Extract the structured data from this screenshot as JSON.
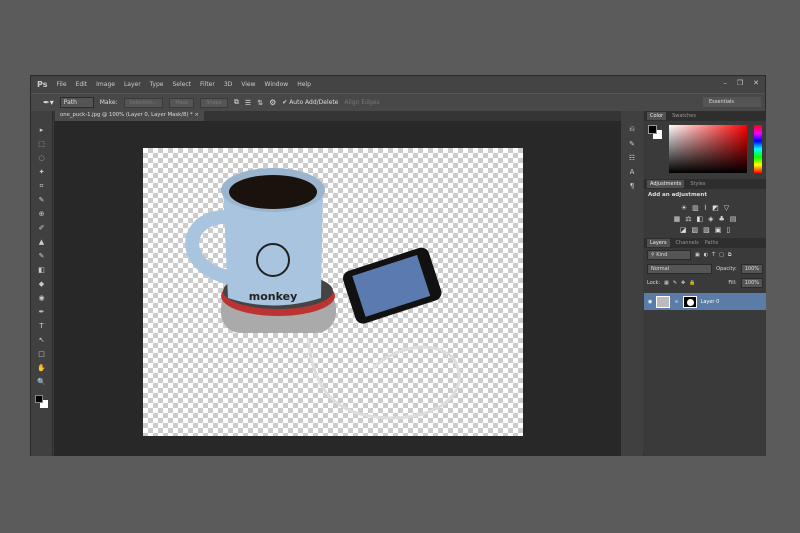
{
  "app": {
    "logo": "Ps"
  },
  "menu": [
    "File",
    "Edit",
    "Image",
    "Layer",
    "Type",
    "Select",
    "Filter",
    "3D",
    "View",
    "Window",
    "Help"
  ],
  "options": {
    "mode": "Path",
    "make_label": "Make:",
    "selection": "Selection...",
    "mask": "Mask",
    "shape": "Shape",
    "auto_add_delete": "Auto Add/Delete",
    "align_edges": "Align Edges",
    "workspace": "Essentials"
  },
  "document": {
    "tab_title": "one_puck-1.jpg @ 100% (Layer 0, Layer Mask/8) *",
    "close": "×"
  },
  "tools": [
    "▸",
    "⬚",
    "◌",
    "✦",
    "⌗",
    "✎",
    "⊕",
    "✐",
    "▲",
    "✎",
    "◧",
    "◆",
    "◉",
    "✒",
    "T",
    "↖",
    "□",
    "✋",
    "🔍"
  ],
  "color_panel": {
    "tabs": [
      "Color",
      "Swatches"
    ],
    "fg": "#000000",
    "bg": "#ffffff"
  },
  "adjustments": {
    "tabs": [
      "Adjustments",
      "Styles"
    ],
    "heading": "Add an adjustment"
  },
  "layers": {
    "tabs": [
      "Layers",
      "Channels",
      "Paths"
    ],
    "filter": "Kind",
    "blend": "Normal",
    "opacity_label": "Opacity:",
    "opacity": "100%",
    "lock_label": "Lock:",
    "fill_label": "Fill:",
    "fill": "100%",
    "items": [
      {
        "name": "Layer 0",
        "selected": true
      }
    ]
  },
  "photo": {
    "mug_text": "monkey"
  }
}
